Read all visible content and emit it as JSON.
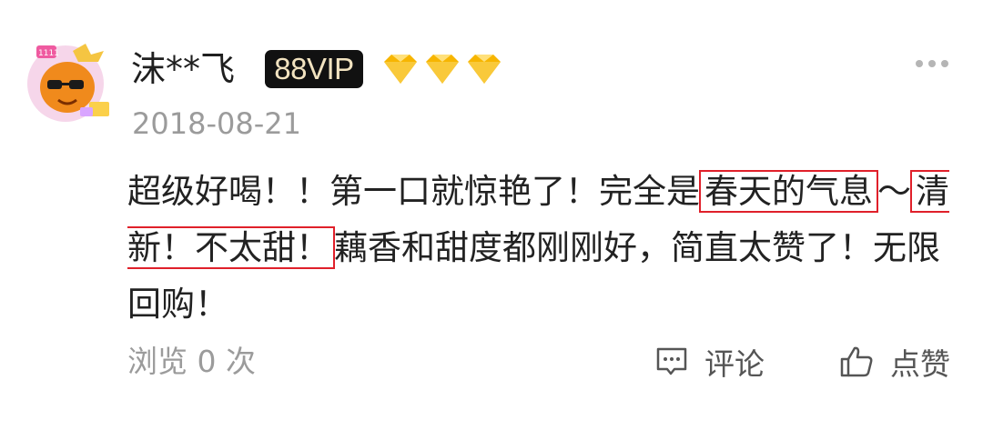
{
  "user": {
    "name": "沫**飞",
    "vip_badge": "88VIP",
    "diamond_level": 3
  },
  "date": "2018-08-21",
  "review": {
    "part1": "超级好喝！！第一口就惊艳了！完全是",
    "highlight1": "春天的气息",
    "part2": "～",
    "highlight2": "清新！不太甜！",
    "part3": "藕香和甜度都刚刚好，简直太赞了！无限回购！"
  },
  "footer": {
    "views": "浏览 0 次",
    "comment_label": "评论",
    "like_label": "点赞"
  },
  "colors": {
    "highlight_border": "#e0202a",
    "vip_badge_bg": "#111111",
    "vip_badge_text": "#f2e3c0",
    "diamond": "#f7b500",
    "muted_text": "#9b9b9b"
  }
}
